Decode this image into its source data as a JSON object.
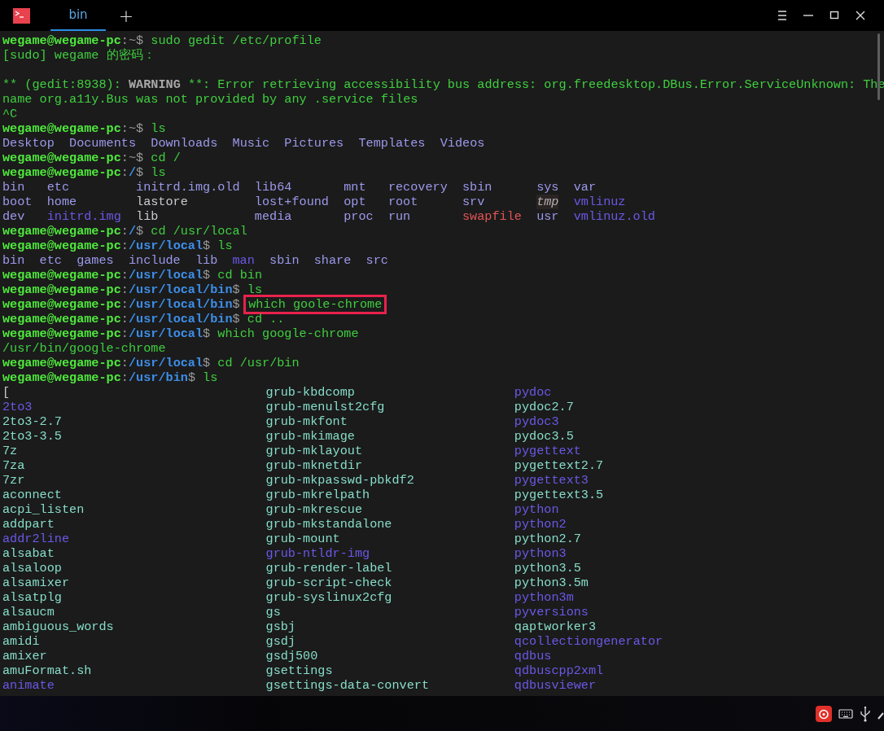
{
  "tabs": [
    {
      "label": "bin",
      "selected": true
    }
  ],
  "new_tab": "+",
  "terminal": [
    {
      "kind": "line",
      "segments": [
        {
          "text": "wegame@wegame-pc",
          "kind": "user"
        },
        {
          "text": ":",
          "kind": "sep"
        },
        {
          "text": "~",
          "kind": "home"
        },
        {
          "text": "$",
          "kind": "sep"
        },
        {
          "text": "sudo gedit /etc/profile",
          "kind": "cmd"
        }
      ]
    },
    {
      "kind": "line",
      "segments": [
        {
          "text": "[sudo] wegame 的密码：",
          "kind": "out"
        }
      ]
    },
    {
      "kind": "blank"
    },
    {
      "kind": "line",
      "segments": [
        {
          "text": "** (gedit:8938): ",
          "kind": "out"
        },
        {
          "text": "WARNING",
          "kind": "warn"
        },
        {
          "text": " **: Error retrieving accessibility bus address: org.freedesktop.DBus.Error.ServiceUnknown: The",
          "kind": "out"
        }
      ]
    },
    {
      "kind": "line",
      "segments": [
        {
          "text": "name org.a11y.Bus was not provided by any .service files",
          "kind": "out"
        }
      ]
    },
    {
      "kind": "line",
      "segments": [
        {
          "text": "^C",
          "kind": "out"
        }
      ]
    },
    {
      "kind": "line",
      "segments": [
        {
          "text": "wegame@wegame-pc",
          "kind": "user"
        },
        {
          "text": ":",
          "kind": "sep"
        },
        {
          "text": "~",
          "kind": "home"
        },
        {
          "text": "$",
          "kind": "sep"
        },
        {
          "text": "ls",
          "kind": "cmd"
        }
      ]
    },
    {
      "kind": "ls",
      "rows": [
        [
          {
            "text": "Desktop",
            "kind": "dir"
          },
          {
            "text": "Documents",
            "kind": "dir"
          },
          {
            "text": "Downloads",
            "kind": "dir"
          },
          {
            "text": "Music",
            "kind": "dir"
          },
          {
            "text": "Pictures",
            "kind": "dir"
          },
          {
            "text": "Templates",
            "kind": "dir"
          },
          {
            "text": "Videos",
            "kind": "dir"
          }
        ]
      ]
    },
    {
      "kind": "line",
      "segments": [
        {
          "text": "wegame@wegame-pc",
          "kind": "user"
        },
        {
          "text": ":",
          "kind": "sep"
        },
        {
          "text": "~",
          "kind": "home"
        },
        {
          "text": "$",
          "kind": "sep"
        },
        {
          "text": "cd /",
          "kind": "cmd"
        }
      ]
    },
    {
      "kind": "line",
      "segments": [
        {
          "text": "wegame@wegame-pc",
          "kind": "user"
        },
        {
          "text": ":",
          "kind": "sep"
        },
        {
          "text": "/",
          "kind": "path"
        },
        {
          "text": "$",
          "kind": "sep"
        },
        {
          "text": "ls",
          "kind": "cmd"
        }
      ]
    },
    {
      "kind": "ls",
      "rows": [
        [
          {
            "text": "bin",
            "kind": "dir"
          },
          {
            "text": "etc",
            "kind": "dir"
          },
          {
            "text": "initrd.img.old",
            "kind": "dir"
          },
          {
            "text": "lib64",
            "kind": "dir"
          },
          {
            "text": "mnt",
            "kind": "dir"
          },
          {
            "text": "recovery",
            "kind": "dir"
          },
          {
            "text": "sbin",
            "kind": "dir"
          },
          {
            "text": "sys",
            "kind": "dir"
          },
          {
            "text": "var",
            "kind": "dir"
          }
        ],
        [
          {
            "text": "boot",
            "kind": "dir"
          },
          {
            "text": "home",
            "kind": "dir"
          },
          {
            "text": "lastore",
            "kind": "plain"
          },
          {
            "text": "lost+found",
            "kind": "dir"
          },
          {
            "text": "opt",
            "kind": "dir"
          },
          {
            "text": "root",
            "kind": "dir"
          },
          {
            "text": "srv",
            "kind": "dir"
          },
          {
            "text": "tmp",
            "kind": "sticky"
          },
          {
            "text": "vmlinuz",
            "kind": "link"
          }
        ],
        [
          {
            "text": "dev",
            "kind": "dir"
          },
          {
            "text": "initrd.img",
            "kind": "link"
          },
          {
            "text": "lib",
            "kind": "plain"
          },
          {
            "text": "media",
            "kind": "dir"
          },
          {
            "text": "proc",
            "kind": "dir"
          },
          {
            "text": "run",
            "kind": "dir"
          },
          {
            "text": "swapfile",
            "kind": "danger"
          },
          {
            "text": "usr",
            "kind": "dir"
          },
          {
            "text": "vmlinuz.old",
            "kind": "link"
          }
        ]
      ]
    },
    {
      "kind": "line",
      "segments": [
        {
          "text": "wegame@wegame-pc",
          "kind": "user"
        },
        {
          "text": ":",
          "kind": "sep"
        },
        {
          "text": "/",
          "kind": "path"
        },
        {
          "text": "$",
          "kind": "sep"
        },
        {
          "text": "cd /usr/local",
          "kind": "cmd"
        }
      ]
    },
    {
      "kind": "line",
      "segments": [
        {
          "text": "wegame@wegame-pc",
          "kind": "user"
        },
        {
          "text": ":",
          "kind": "sep"
        },
        {
          "text": "/usr/local",
          "kind": "path"
        },
        {
          "text": "$",
          "kind": "sep"
        },
        {
          "text": "ls",
          "kind": "cmd"
        }
      ]
    },
    {
      "kind": "ls",
      "rows": [
        [
          {
            "text": "bin",
            "kind": "dir"
          },
          {
            "text": "etc",
            "kind": "dir"
          },
          {
            "text": "games",
            "kind": "dir"
          },
          {
            "text": "include",
            "kind": "dir"
          },
          {
            "text": "lib",
            "kind": "dir"
          },
          {
            "text": "man",
            "kind": "link"
          },
          {
            "text": "sbin",
            "kind": "dir"
          },
          {
            "text": "share",
            "kind": "dir"
          },
          {
            "text": "src",
            "kind": "dir"
          }
        ]
      ]
    },
    {
      "kind": "line",
      "segments": [
        {
          "text": "wegame@wegame-pc",
          "kind": "user"
        },
        {
          "text": ":",
          "kind": "sep"
        },
        {
          "text": "/usr/local",
          "kind": "path"
        },
        {
          "text": "$",
          "kind": "sep"
        },
        {
          "text": "cd bin",
          "kind": "cmd"
        }
      ]
    },
    {
      "kind": "line",
      "segments": [
        {
          "text": "wegame@wegame-pc",
          "kind": "user"
        },
        {
          "text": ":",
          "kind": "sep"
        },
        {
          "text": "/usr/local/bin",
          "kind": "path"
        },
        {
          "text": "$",
          "kind": "sep"
        },
        {
          "text": "ls",
          "kind": "cmd"
        }
      ]
    },
    {
      "kind": "line",
      "segments": [
        {
          "text": "wegame@wegame-pc",
          "kind": "user"
        },
        {
          "text": ":",
          "kind": "sep"
        },
        {
          "text": "/usr/local/bin",
          "kind": "path"
        },
        {
          "text": "$",
          "kind": "sep"
        },
        {
          "text": "which goole-chrome",
          "kind": "cmd",
          "boxed": true
        }
      ]
    },
    {
      "kind": "line",
      "segments": [
        {
          "text": "wegame@wegame-pc",
          "kind": "user"
        },
        {
          "text": ":",
          "kind": "sep"
        },
        {
          "text": "/usr/local/bin",
          "kind": "path"
        },
        {
          "text": "$",
          "kind": "sep"
        },
        {
          "text": "cd ..",
          "kind": "cmd"
        }
      ]
    },
    {
      "kind": "line",
      "segments": [
        {
          "text": "wegame@wegame-pc",
          "kind": "user"
        },
        {
          "text": ":",
          "kind": "sep"
        },
        {
          "text": "/usr/local",
          "kind": "path"
        },
        {
          "text": "$",
          "kind": "sep"
        },
        {
          "text": "which google-chrome",
          "kind": "cmd"
        }
      ]
    },
    {
      "kind": "line",
      "segments": [
        {
          "text": "/usr/bin/google-chrome",
          "kind": "out"
        }
      ]
    },
    {
      "kind": "line",
      "segments": [
        {
          "text": "wegame@wegame-pc",
          "kind": "user"
        },
        {
          "text": ":",
          "kind": "sep"
        },
        {
          "text": "/usr/local",
          "kind": "path"
        },
        {
          "text": "$",
          "kind": "sep"
        },
        {
          "text": "cd /usr/bin",
          "kind": "cmd"
        }
      ]
    },
    {
      "kind": "line",
      "segments": [
        {
          "text": "wegame@wegame-pc",
          "kind": "user"
        },
        {
          "text": ":",
          "kind": "sep"
        },
        {
          "text": "/usr/bin",
          "kind": "path"
        },
        {
          "text": "$",
          "kind": "sep"
        },
        {
          "text": "ls",
          "kind": "cmd"
        }
      ]
    },
    {
      "kind": "ls-wide",
      "rows": [
        [
          {
            "text": "[",
            "kind": "plain"
          },
          {
            "text": "grub-kbdcomp",
            "kind": "exec"
          },
          {
            "text": "pydoc",
            "kind": "link"
          }
        ],
        [
          {
            "text": "2to3",
            "kind": "link"
          },
          {
            "text": "grub-menulst2cfg",
            "kind": "exec"
          },
          {
            "text": "pydoc2.7",
            "kind": "exec"
          }
        ],
        [
          {
            "text": "2to3-2.7",
            "kind": "exec"
          },
          {
            "text": "grub-mkfont",
            "kind": "exec"
          },
          {
            "text": "pydoc3",
            "kind": "link"
          }
        ],
        [
          {
            "text": "2to3-3.5",
            "kind": "exec"
          },
          {
            "text": "grub-mkimage",
            "kind": "exec"
          },
          {
            "text": "pydoc3.5",
            "kind": "exec"
          }
        ],
        [
          {
            "text": "7z",
            "kind": "exec"
          },
          {
            "text": "grub-mklayout",
            "kind": "exec"
          },
          {
            "text": "pygettext",
            "kind": "link"
          }
        ],
        [
          {
            "text": "7za",
            "kind": "exec"
          },
          {
            "text": "grub-mknetdir",
            "kind": "exec"
          },
          {
            "text": "pygettext2.7",
            "kind": "exec"
          }
        ],
        [
          {
            "text": "7zr",
            "kind": "exec"
          },
          {
            "text": "grub-mkpasswd-pbkdf2",
            "kind": "exec"
          },
          {
            "text": "pygettext3",
            "kind": "link"
          }
        ],
        [
          {
            "text": "aconnect",
            "kind": "exec"
          },
          {
            "text": "grub-mkrelpath",
            "kind": "exec"
          },
          {
            "text": "pygettext3.5",
            "kind": "exec"
          }
        ],
        [
          {
            "text": "acpi_listen",
            "kind": "exec"
          },
          {
            "text": "grub-mkrescue",
            "kind": "exec"
          },
          {
            "text": "python",
            "kind": "link"
          }
        ],
        [
          {
            "text": "addpart",
            "kind": "exec"
          },
          {
            "text": "grub-mkstandalone",
            "kind": "exec"
          },
          {
            "text": "python2",
            "kind": "link"
          }
        ],
        [
          {
            "text": "addr2line",
            "kind": "link"
          },
          {
            "text": "grub-mount",
            "kind": "exec"
          },
          {
            "text": "python2.7",
            "kind": "exec"
          }
        ],
        [
          {
            "text": "alsabat",
            "kind": "exec"
          },
          {
            "text": "grub-ntldr-img",
            "kind": "link"
          },
          {
            "text": "python3",
            "kind": "link"
          }
        ],
        [
          {
            "text": "alsaloop",
            "kind": "exec"
          },
          {
            "text": "grub-render-label",
            "kind": "exec"
          },
          {
            "text": "python3.5",
            "kind": "exec"
          }
        ],
        [
          {
            "text": "alsamixer",
            "kind": "exec"
          },
          {
            "text": "grub-script-check",
            "kind": "exec"
          },
          {
            "text": "python3.5m",
            "kind": "exec"
          }
        ],
        [
          {
            "text": "alsatplg",
            "kind": "exec"
          },
          {
            "text": "grub-syslinux2cfg",
            "kind": "exec"
          },
          {
            "text": "python3m",
            "kind": "link"
          }
        ],
        [
          {
            "text": "alsaucm",
            "kind": "exec"
          },
          {
            "text": "gs",
            "kind": "exec"
          },
          {
            "text": "pyversions",
            "kind": "link"
          }
        ],
        [
          {
            "text": "ambiguous_words",
            "kind": "exec"
          },
          {
            "text": "gsbj",
            "kind": "exec"
          },
          {
            "text": "qaptworker3",
            "kind": "exec"
          }
        ],
        [
          {
            "text": "amidi",
            "kind": "exec"
          },
          {
            "text": "gsdj",
            "kind": "exec"
          },
          {
            "text": "qcollectiongenerator",
            "kind": "link"
          }
        ],
        [
          {
            "text": "amixer",
            "kind": "exec"
          },
          {
            "text": "gsdj500",
            "kind": "exec"
          },
          {
            "text": "qdbus",
            "kind": "link"
          }
        ],
        [
          {
            "text": "amuFormat.sh",
            "kind": "exec"
          },
          {
            "text": "gsettings",
            "kind": "exec"
          },
          {
            "text": "qdbuscpp2xml",
            "kind": "link"
          }
        ],
        [
          {
            "text": "animate",
            "kind": "link"
          },
          {
            "text": "gsettings-data-convert",
            "kind": "exec"
          },
          {
            "text": "qdbusviewer",
            "kind": "link"
          }
        ]
      ]
    }
  ]
}
